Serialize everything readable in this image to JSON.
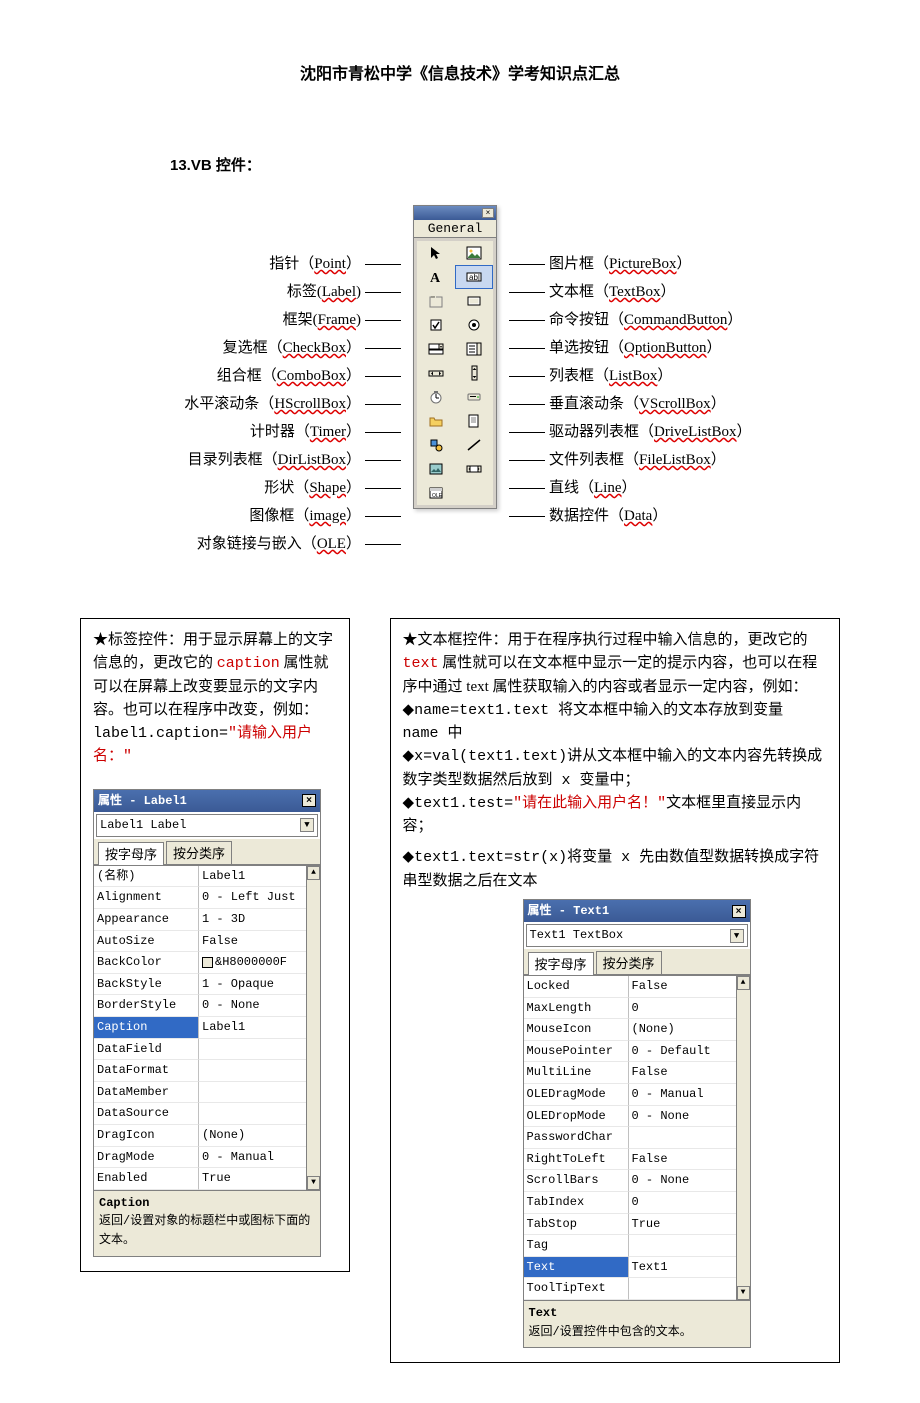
{
  "doc": {
    "title": "沈阳市青松中学《信息技术》学考知识点汇总",
    "section_head": "13.VB 控件："
  },
  "toolbox": {
    "tab_label": "General",
    "left_labels": [
      "指针（Point）",
      "标签(Label)",
      "框架(Frame)",
      "复选框（CheckBox）",
      "组合框（ComboBox）",
      "水平滚动条（HScrollBox）",
      "计时器（Timer）",
      "目录列表框（DirListBox）",
      "形状（Shape）",
      "图像框（image）",
      "对象链接与嵌入（OLE）"
    ],
    "right_labels": [
      "图片框（PictureBox）",
      "文本框（TextBox）",
      "命令按钮（CommandButton）",
      "单选按钮（OptionButton）",
      "列表框（ListBox）",
      "垂直滚动条（VScrollBox）",
      "驱动器列表框（DriveListBox）",
      "文件列表框（FileListBox）",
      "直线（Line）",
      "数据控件（Data）"
    ],
    "icons": [
      "pointer",
      "picturebox",
      "label",
      "textbox",
      "frame",
      "commandbutton",
      "checkbox",
      "optionbutton",
      "combobox",
      "listbox",
      "hscroll",
      "vscroll",
      "timer",
      "drivelist",
      "dirlist",
      "filelist",
      "shape",
      "line",
      "image",
      "data",
      "ole",
      "blank"
    ]
  },
  "leftbox": {
    "p1a": "★标签控件：用于显示屏幕上的文字信息的，更改它的 ",
    "p1b": "caption",
    "p1c": " 属性就可以在屏幕上改变要显示的文字内容。也可以在程序中改变，例如：",
    "p2a": "label1.caption=",
    "p2b": "\"请输入用户名：\""
  },
  "rightbox": {
    "p1a": "★文本框控件：用于在程序执行过程中输入信息的，更改它的",
    "p1b": "text",
    "p1c": " 属性就可以在文本框中显示一定的提示内容，也可以在程序中通过 text 属性获取输入的内容或者显示一定内容，例如：",
    "p2": "◆name=text1.text 将文本框中输入的文本存放到变量 name 中",
    "p3": "◆x=val(text1.text)讲从文本框中输入的文本内容先转换成数字类型数据然后放到 x 变量中；",
    "p4a": "◆text1.test=",
    "p4b": "\"请在此输入用户名！\"",
    "p4c": "文本框里直接显示内容；",
    "p5": "◆text1.text=str(x)将变量 x 先由数值型数据转换成字符串型数据之后在文本"
  },
  "propwin_label": {
    "title": "属性 - Label1",
    "combo": "Label1 Label",
    "tabs": [
      "按字母序",
      "按分类序"
    ],
    "rows": [
      {
        "k": "(名称)",
        "v": "Label1"
      },
      {
        "k": "Alignment",
        "v": "0 - Left Just"
      },
      {
        "k": "Appearance",
        "v": "1 - 3D"
      },
      {
        "k": "AutoSize",
        "v": "False"
      },
      {
        "k": "BackColor",
        "v": "&H8000000F"
      },
      {
        "k": "BackStyle",
        "v": "1 - Opaque"
      },
      {
        "k": "BorderStyle",
        "v": "0 - None"
      },
      {
        "k": "Caption",
        "v": "Label1",
        "sel": true
      },
      {
        "k": "DataField",
        "v": ""
      },
      {
        "k": "DataFormat",
        "v": ""
      },
      {
        "k": "DataMember",
        "v": ""
      },
      {
        "k": "DataSource",
        "v": ""
      },
      {
        "k": "DragIcon",
        "v": "(None)"
      },
      {
        "k": "DragMode",
        "v": "0 - Manual"
      },
      {
        "k": "Enabled",
        "v": "True"
      }
    ],
    "desc_title": "Caption",
    "desc_body": "返回/设置对象的标题栏中或图标下面的文本。"
  },
  "propwin_text": {
    "title": "属性 - Text1",
    "combo": "Text1 TextBox",
    "tabs": [
      "按字母序",
      "按分类序"
    ],
    "rows": [
      {
        "k": "Locked",
        "v": "False"
      },
      {
        "k": "MaxLength",
        "v": "0"
      },
      {
        "k": "MouseIcon",
        "v": "(None)"
      },
      {
        "k": "MousePointer",
        "v": "0 - Default"
      },
      {
        "k": "MultiLine",
        "v": "False"
      },
      {
        "k": "OLEDragMode",
        "v": "0 - Manual"
      },
      {
        "k": "OLEDropMode",
        "v": "0 - None"
      },
      {
        "k": "PasswordChar",
        "v": ""
      },
      {
        "k": "RightToLeft",
        "v": "False"
      },
      {
        "k": "ScrollBars",
        "v": "0 - None"
      },
      {
        "k": "TabIndex",
        "v": "0"
      },
      {
        "k": "TabStop",
        "v": "True"
      },
      {
        "k": "Tag",
        "v": ""
      },
      {
        "k": "Text",
        "v": "Text1",
        "sel": true
      },
      {
        "k": "ToolTipText",
        "v": ""
      }
    ],
    "desc_title": "Text",
    "desc_body": "返回/设置控件中包含的文本。"
  }
}
